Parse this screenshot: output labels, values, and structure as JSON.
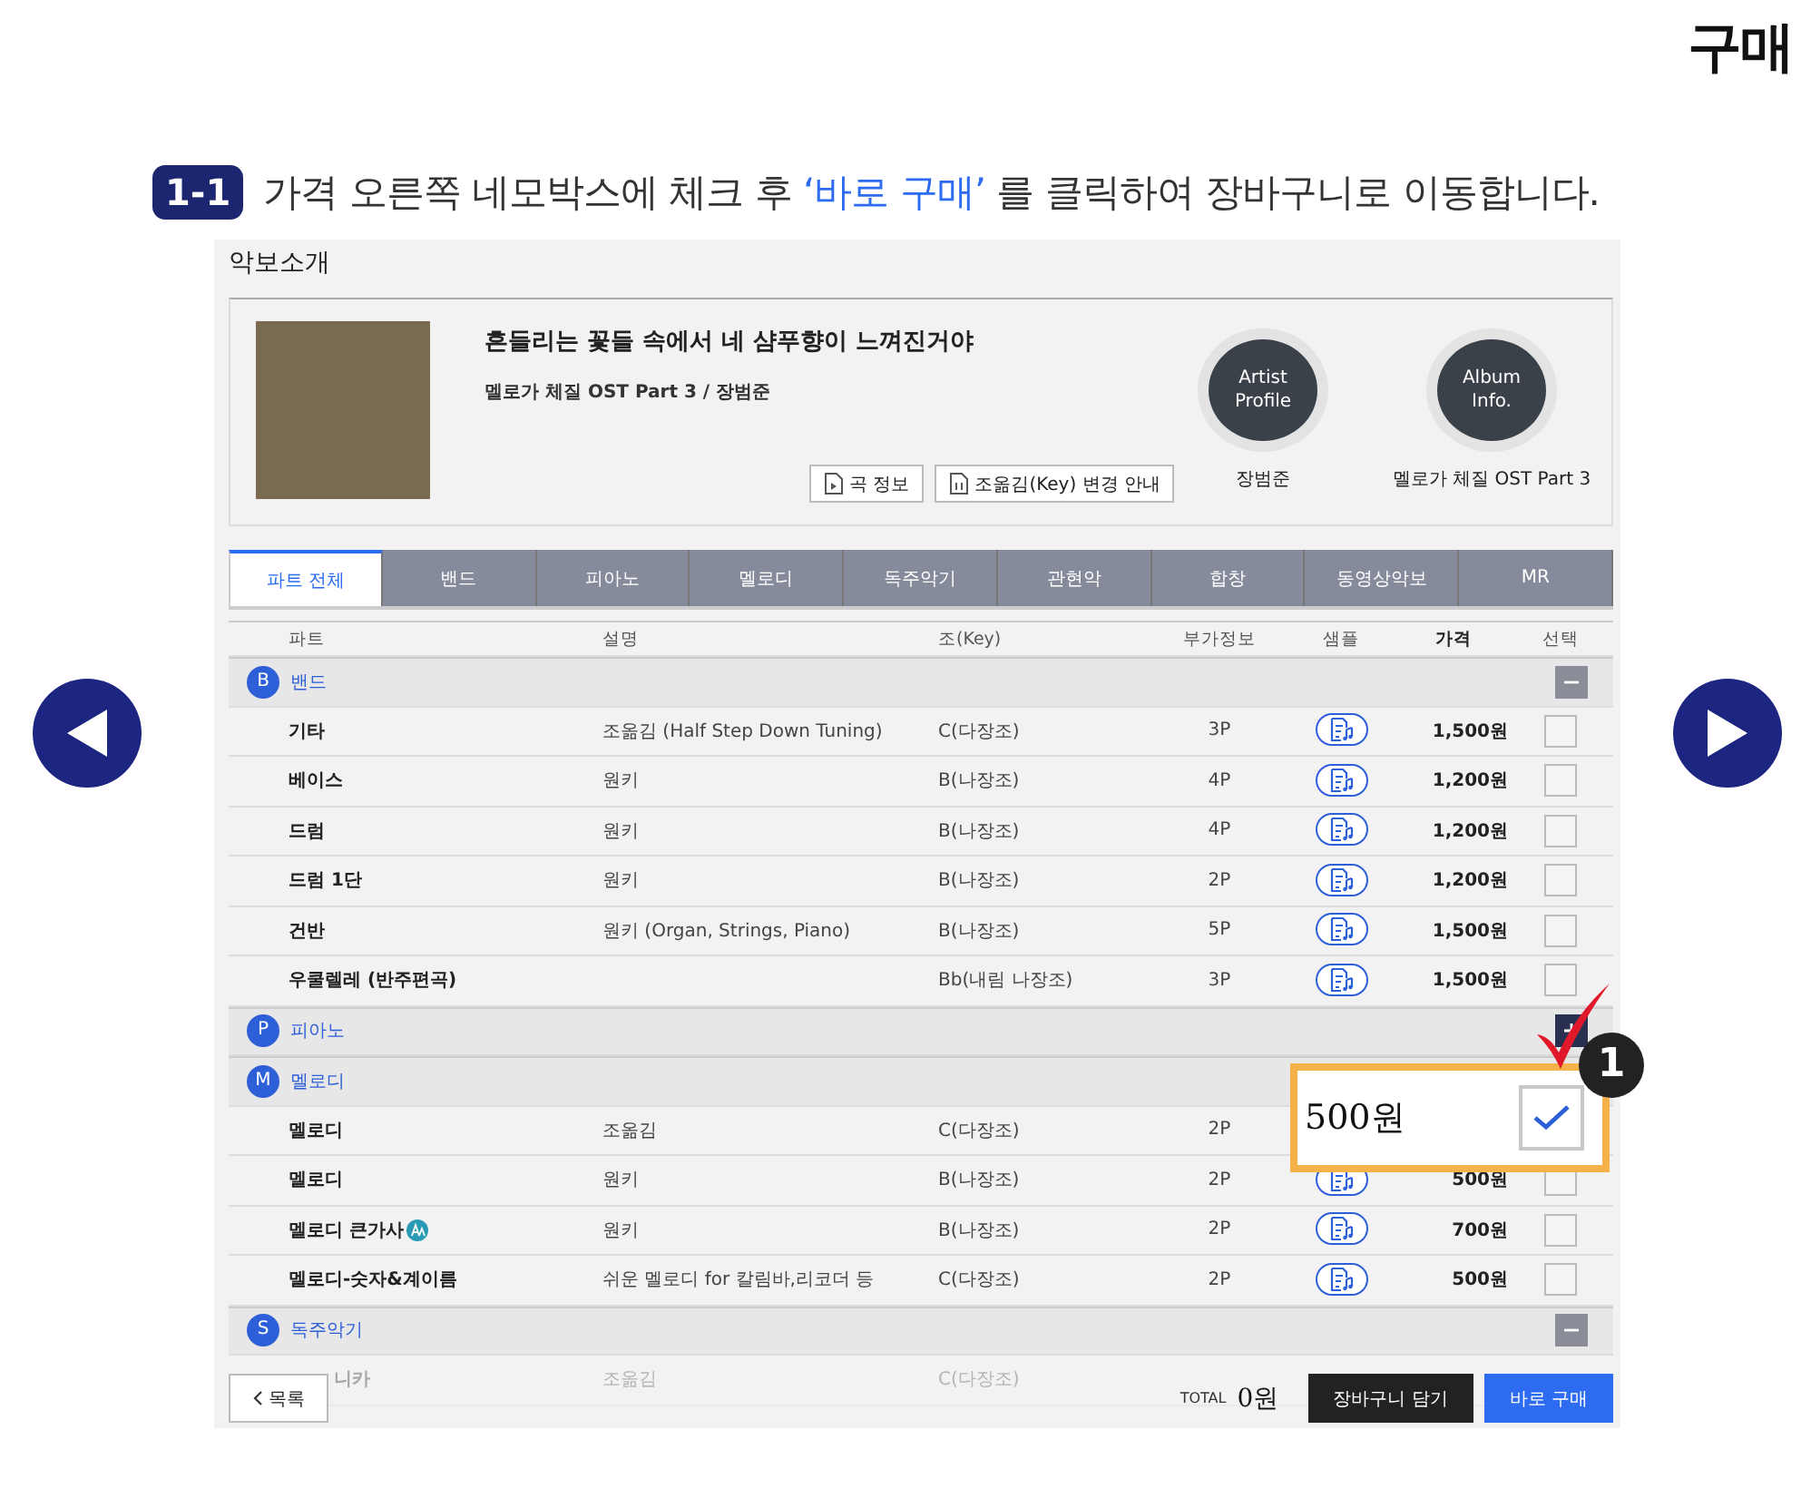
{
  "corner_title": "구매",
  "instruction": {
    "step": "1-1",
    "parts": [
      {
        "text": "가격 오른쪽 네모박스에 체크 후 ",
        "highlight": false
      },
      {
        "text": "‘바로 구매’",
        "highlight": true
      },
      {
        "text": " 를 클릭하여 장바구니로 이동합니다.",
        "highlight": false
      }
    ]
  },
  "screen": {
    "heading": "악보소개",
    "song": {
      "title": "흔들리는 꽃들 속에서 네 샴푸향이 느껴진거야",
      "subtitle": "멜로가 체질 OST Part 3 / 장범준",
      "buttons": [
        "곡 정보",
        "조옮김(Key) 변경 안내"
      ],
      "profiles": [
        {
          "circle_text": "Artist Profile",
          "caption": "장범준"
        },
        {
          "circle_text": "Album Info.",
          "caption": "멜로가 체질 OST Part 3"
        }
      ]
    },
    "tabs": [
      {
        "label": "파트 전체",
        "selected": true
      },
      {
        "label": "밴드",
        "selected": false
      },
      {
        "label": "피아노",
        "selected": false
      },
      {
        "label": "멜로디",
        "selected": false
      },
      {
        "label": "독주악기",
        "selected": false
      },
      {
        "label": "관현악",
        "selected": false
      },
      {
        "label": "합창",
        "selected": false
      },
      {
        "label": "동영상악보",
        "selected": false
      },
      {
        "label": "MR",
        "selected": false
      }
    ],
    "columns": [
      "파트",
      "설명",
      "조(Key)",
      "부가정보",
      "샘플",
      "가격",
      "선택"
    ],
    "groups": [
      {
        "letter": "B",
        "name": "밴드",
        "expanded": true,
        "rows": [
          {
            "part": "기타",
            "description": "조옮김 (Half Step Down Tuning)",
            "key": "C(다장조)",
            "pages": "3P",
            "price": "1,500원",
            "checked": false,
            "lyrics_icon": false
          },
          {
            "part": "베이스",
            "description": "원키",
            "key": "B(나장조)",
            "pages": "4P",
            "price": "1,200원",
            "checked": false,
            "lyrics_icon": false
          },
          {
            "part": "드럼",
            "description": "원키",
            "key": "B(나장조)",
            "pages": "4P",
            "price": "1,200원",
            "checked": false,
            "lyrics_icon": false
          },
          {
            "part": "드럼 1단",
            "description": "원키",
            "key": "B(나장조)",
            "pages": "2P",
            "price": "1,200원",
            "checked": false,
            "lyrics_icon": false
          },
          {
            "part": "건반",
            "description": "원키 (Organ, Strings, Piano)",
            "key": "B(나장조)",
            "pages": "5P",
            "price": "1,500원",
            "checked": false,
            "lyrics_icon": false
          },
          {
            "part": "우쿨렐레 (반주편곡)",
            "description": "",
            "key": "Bb(내림 나장조)",
            "pages": "3P",
            "price": "1,500원",
            "checked": false,
            "lyrics_icon": false
          }
        ]
      },
      {
        "letter": "P",
        "name": "피아노",
        "expanded": false
      },
      {
        "letter": "M",
        "name": "멜로디",
        "rows": [
          {
            "part": "멜로디",
            "description": "조옮김",
            "key": "C(다장조)",
            "pages": "2P",
            "lyrics_icon": false
          },
          {
            "part": "멜로디",
            "description": "원키",
            "key": "B(나장조)",
            "pages": "2P",
            "price": "500원",
            "checked": false,
            "lyrics_icon": false
          },
          {
            "part": "멜로디 큰가사",
            "description": "원키",
            "key": "B(나장조)",
            "pages": "2P",
            "price": "700원",
            "checked": false,
            "lyrics_icon": true
          },
          {
            "part": "멜로디-숫자&계이름",
            "description": "쉬운 멜로디 for 칼림바,리코더 등",
            "key": "C(다장조)",
            "pages": "2P",
            "price": "500원",
            "checked": false,
            "lyrics_icon": false
          }
        ]
      },
      {
        "letter": "S",
        "name": "독주악기",
        "expanded": true,
        "rows": [
          {
            "part": "니카",
            "description": "조옮김",
            "key": "C(다장조)",
            "faded": true,
            "lyrics_icon": false
          }
        ]
      }
    ],
    "footer": {
      "back": "목록",
      "total_label": "TOTAL",
      "total": "0원",
      "cart": "장바구니 담기",
      "buy": "바로 구매"
    },
    "callout": {
      "price": "500원",
      "checked": true,
      "number": "1"
    }
  }
}
